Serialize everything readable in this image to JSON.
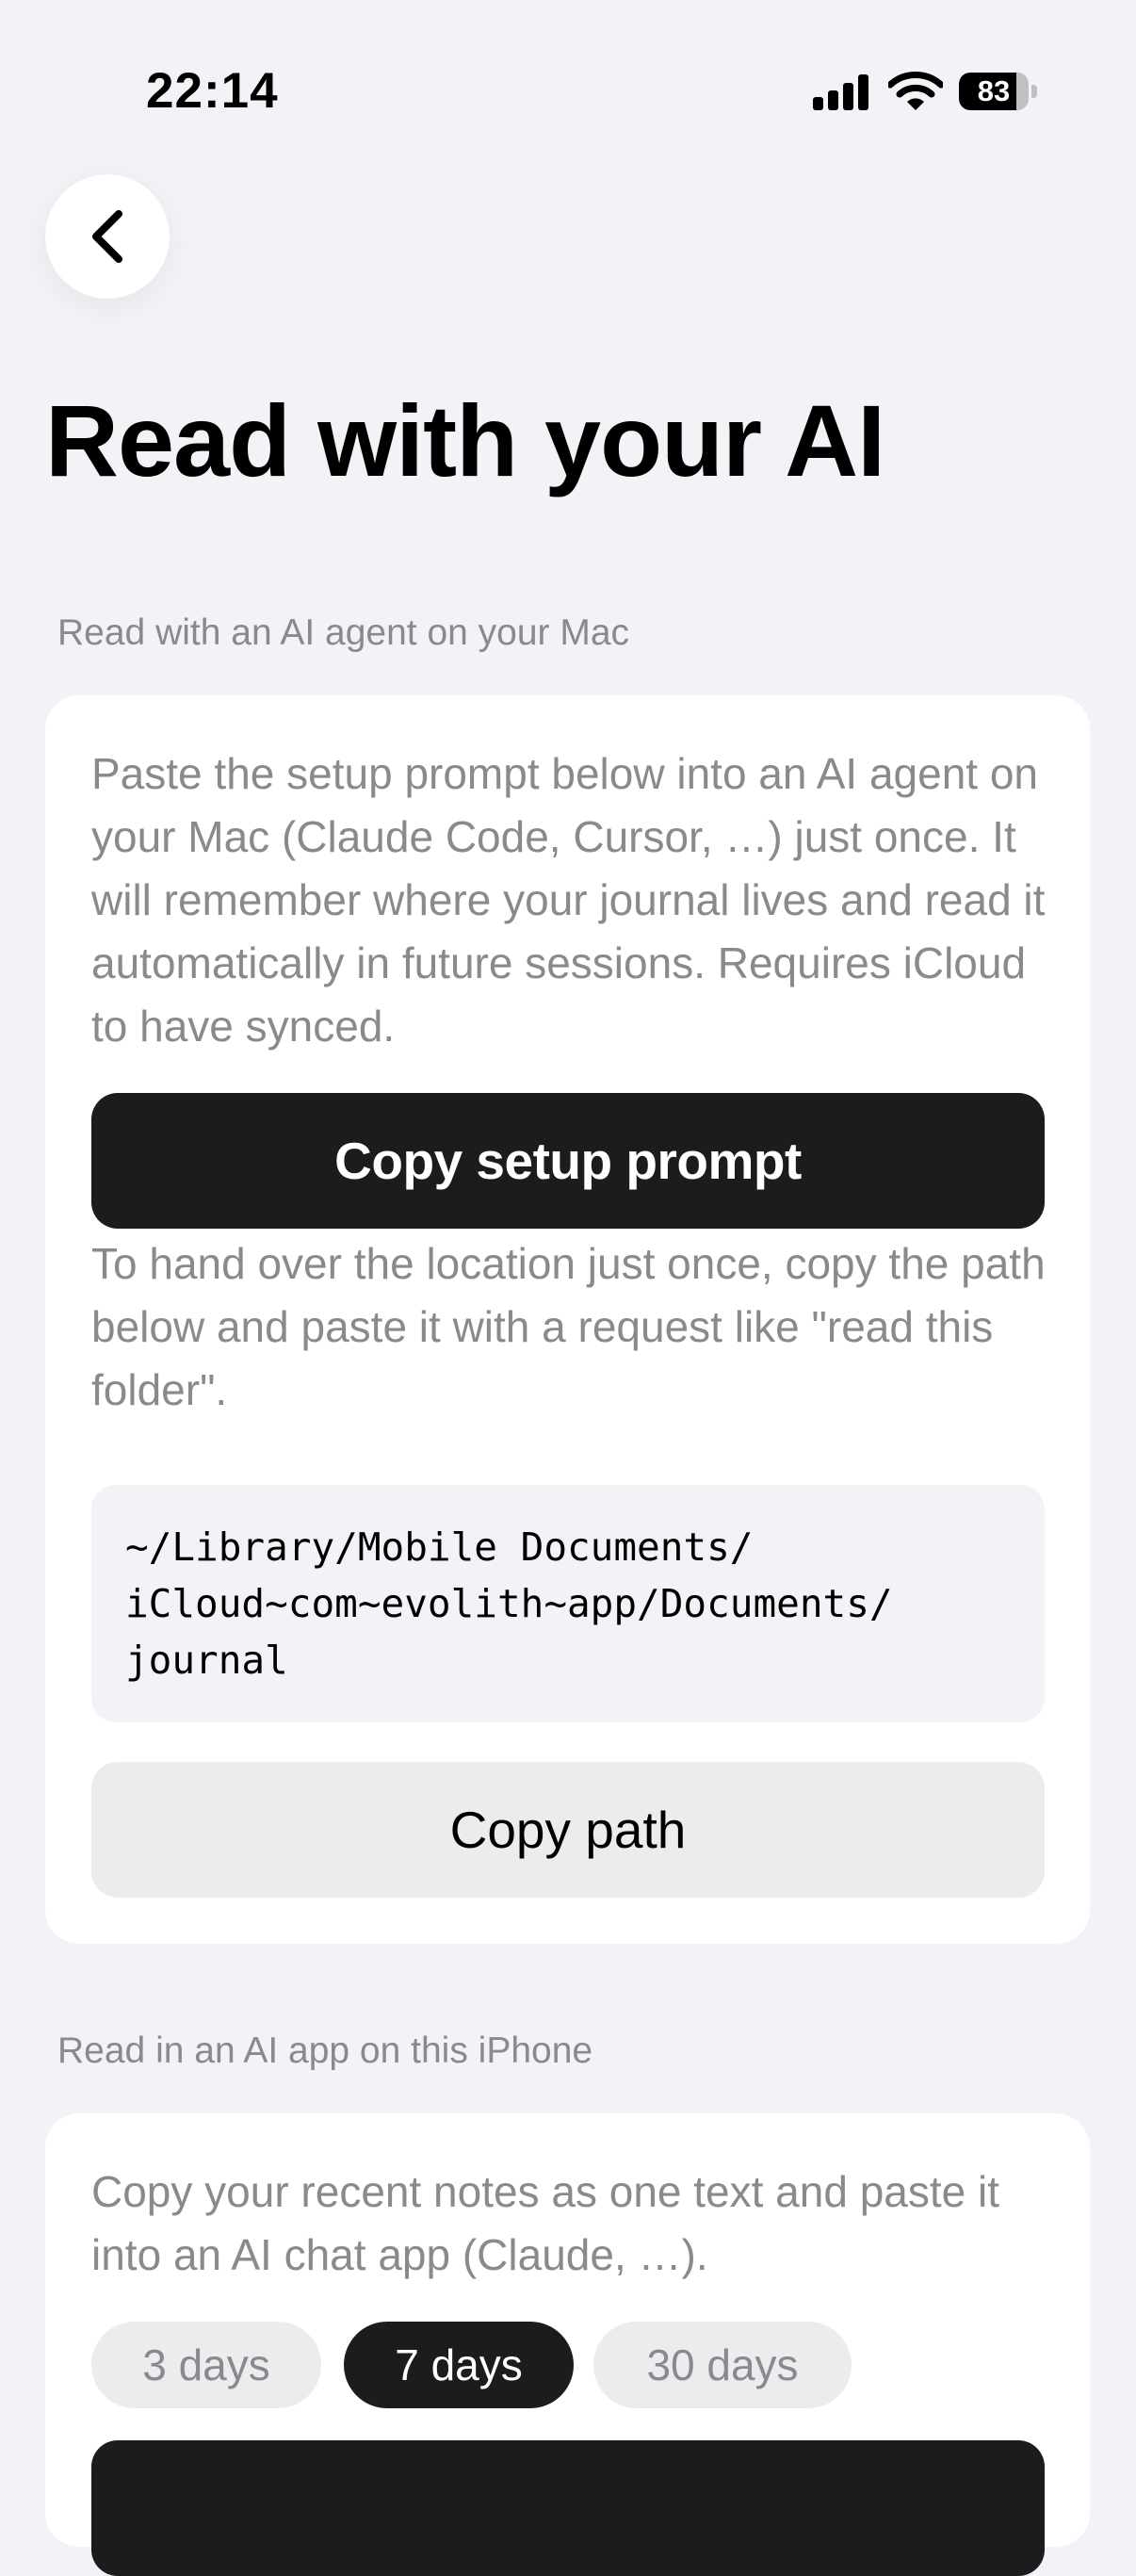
{
  "status_bar": {
    "time": "22:14",
    "battery_level": "83",
    "battery_fraction": 0.83,
    "icons": [
      "cellular-signal-icon",
      "wifi-icon",
      "battery-icon"
    ]
  },
  "nav": {
    "back_icon": "chevron-left-icon"
  },
  "page_title": "Read with your AI",
  "mac_section": {
    "header": "Read with an AI agent on your Mac",
    "intro": "Paste the setup prompt below into an AI agent on your Mac (Claude Code, Cursor, …) just once. It will remember where your journal lives and read it automatically in future sessions. Requires iCloud to have synced.",
    "copy_prompt_label": "Copy setup prompt",
    "path_hint": "To hand over the location just once, copy the path below and paste it with a request like \"read this folder\".",
    "path": "~/Library/Mobile Documents/\niCloud~com~evolith~app/Documents/\njournal",
    "copy_path_label": "Copy path"
  },
  "iphone_section": {
    "header": "Read in an AI app on this iPhone",
    "intro": "Copy your recent notes as one text and paste it into an AI chat app (Claude, …).",
    "range_options": [
      "3 days",
      "7 days",
      "30 days"
    ],
    "selected_range": "7 days"
  },
  "colors": {
    "background": "#f2f2f7",
    "card": "#ffffff",
    "primary_button": "#1c1c1e",
    "secondary_button": "#ececee",
    "secondary_text": "#8a8a8e"
  }
}
